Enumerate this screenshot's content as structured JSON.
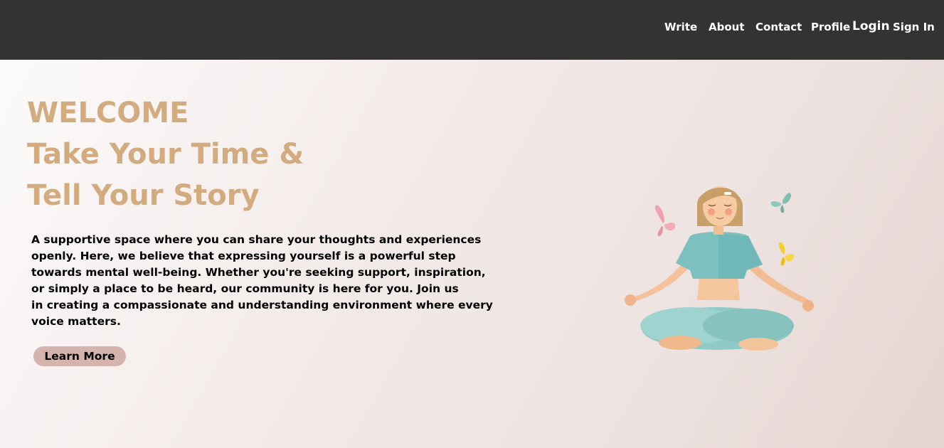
{
  "nav": {
    "items": [
      {
        "label": "Write"
      },
      {
        "label": "About"
      },
      {
        "label": "Contact"
      },
      {
        "label": "Profile"
      },
      {
        "label": "Login"
      },
      {
        "label": "Sign In"
      }
    ]
  },
  "hero": {
    "headline": [
      "WELCOME",
      "Take Your Time &",
      "Tell Your Story"
    ],
    "description_lines": [
      "A supportive space where you can share your thoughts and experiences",
      "openly. Here, we believe that expressing yourself is a powerful step",
      "towards mental well-being. Whether you're seeking support, inspiration,",
      "or simply a place to be heard, our community is here for you. Join us",
      "in creating a compassionate and understanding environment where every",
      "voice matters."
    ],
    "button_label": "Learn More",
    "illustration_icon": "meditating-woman-with-butterflies-illustration"
  },
  "colors": {
    "navbar": "#333333",
    "headline": "#d2ab7f",
    "button": "#d6b4ae"
  }
}
